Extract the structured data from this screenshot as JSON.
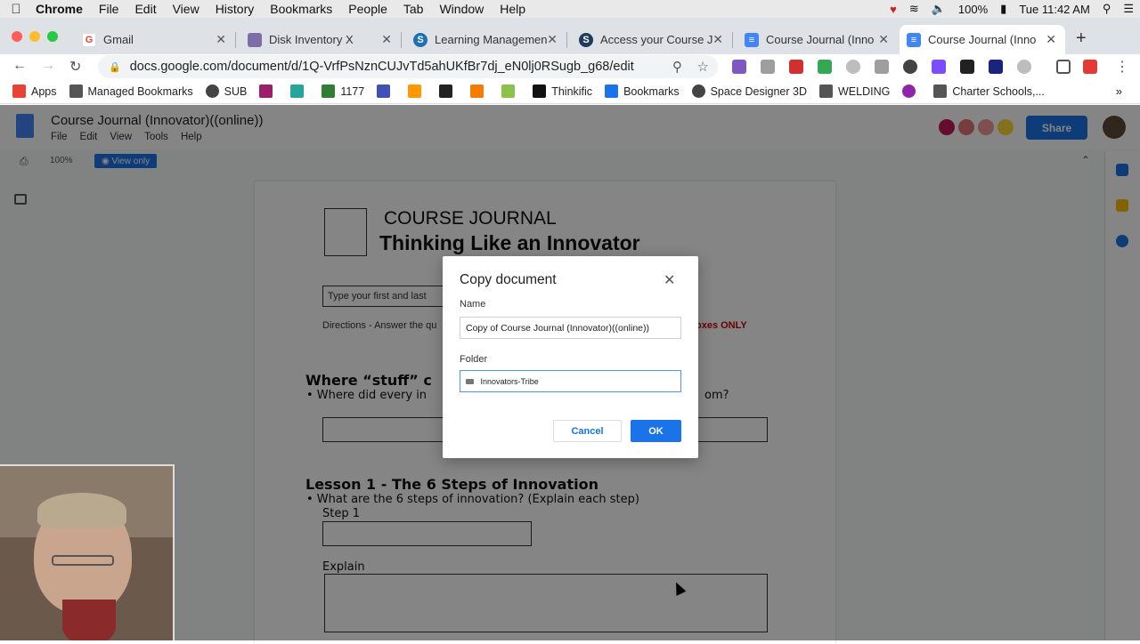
{
  "macbar": {
    "app": "Chrome",
    "menus": [
      "File",
      "Edit",
      "View",
      "History",
      "Bookmarks",
      "People",
      "Tab",
      "Window",
      "Help"
    ],
    "battery": "100%",
    "clock": "Tue 11:42 AM"
  },
  "tabs": [
    {
      "label": "Gmail",
      "icon": "gmail-icon",
      "color": "#ffffff"
    },
    {
      "label": "Disk Inventory X",
      "icon": "disk-inventory-icon",
      "color": "#7d6ea8"
    },
    {
      "label": "Learning Managemen",
      "icon": "schoology-icon",
      "color": "#1f6fb5"
    },
    {
      "label": "Access your Course J",
      "icon": "schoology-icon",
      "color": "#1f3a5a"
    },
    {
      "label": "Course Journal (Inno",
      "icon": "docs-icon",
      "color": "#4285f4"
    },
    {
      "label": "Course Journal (Inno",
      "icon": "docs-icon",
      "color": "#4285f4"
    }
  ],
  "omnibox": {
    "url": "docs.google.com/document/d/1Q-VrfPsNznCUJvTd5ahUKfBr7dj_eN0lj0RSugb_g68/edit"
  },
  "bookmarks": [
    {
      "label": "Apps",
      "icon": "apps-grid-icon",
      "color": "#e94235"
    },
    {
      "label": "Managed Bookmarks",
      "icon": "folder-icon",
      "color": "#555555"
    },
    {
      "label": "SUB",
      "icon": "globe-icon",
      "color": "#444444"
    },
    {
      "label": "",
      "icon": "slash-icon",
      "color": "#9b1f6a"
    },
    {
      "label": "",
      "icon": "hat-icon",
      "color": "#26a69a"
    },
    {
      "label": "1177",
      "icon": "bars-icon",
      "color": "#2e7d32"
    },
    {
      "label": "",
      "icon": "grid-icon",
      "color": "#3f51b5"
    },
    {
      "label": "",
      "icon": "colorgrid-icon",
      "color": "#ff9800"
    },
    {
      "label": "",
      "icon": "pnct-icon",
      "color": "#222222"
    },
    {
      "label": "",
      "icon": "its-icon",
      "color": "#f57c00"
    },
    {
      "label": "",
      "icon": "c-icon",
      "color": "#8bc34a"
    },
    {
      "label": "Thinkific",
      "icon": "thinkific-icon",
      "color": "#111111"
    },
    {
      "label": "Bookmarks",
      "icon": "star-icon",
      "color": "#1a73e8"
    },
    {
      "label": "Space Designer 3D",
      "icon": "globe-icon",
      "color": "#444444"
    },
    {
      "label": "WELDING",
      "icon": "folder-icon",
      "color": "#555555"
    },
    {
      "label": "",
      "icon": "loop-icon",
      "color": "#8e24aa"
    },
    {
      "label": "Charter Schools,...",
      "icon": "folder-icon",
      "color": "#555555"
    }
  ],
  "docs": {
    "title": "Course Journal (Innovator)((online))",
    "menus": [
      "File",
      "Edit",
      "View",
      "Tools",
      "Help"
    ],
    "zoom": "100%",
    "mode": "View only",
    "share": "Share"
  },
  "page": {
    "title": "COURSE JOURNAL",
    "subtitle": "Thinking Like an Innovator",
    "name_prompt": "Type your first and last",
    "directions": "Directions - Answer the qu",
    "red_note": "oxes ONLY",
    "section1": "Where “stuff” c",
    "q1": "•  Where did every in",
    "q1_tail": "om?",
    "section2": "Lesson 1 - The 6 Steps of Innovation",
    "q2": "•  What are the 6 steps of innovation? (Explain each step)",
    "step1": "Step 1",
    "explain": "Explain"
  },
  "dialog": {
    "title": "Copy document",
    "name_label": "Name",
    "name_value": "Copy of Course Journal (Innovator)((online))",
    "folder_label": "Folder",
    "folder_value": "Innovators-Tribe",
    "cancel": "Cancel",
    "ok": "OK"
  },
  "colors": {
    "accent": "#1a73e8",
    "dialog_overlay": "rgba(0,0,0,0.48)"
  }
}
